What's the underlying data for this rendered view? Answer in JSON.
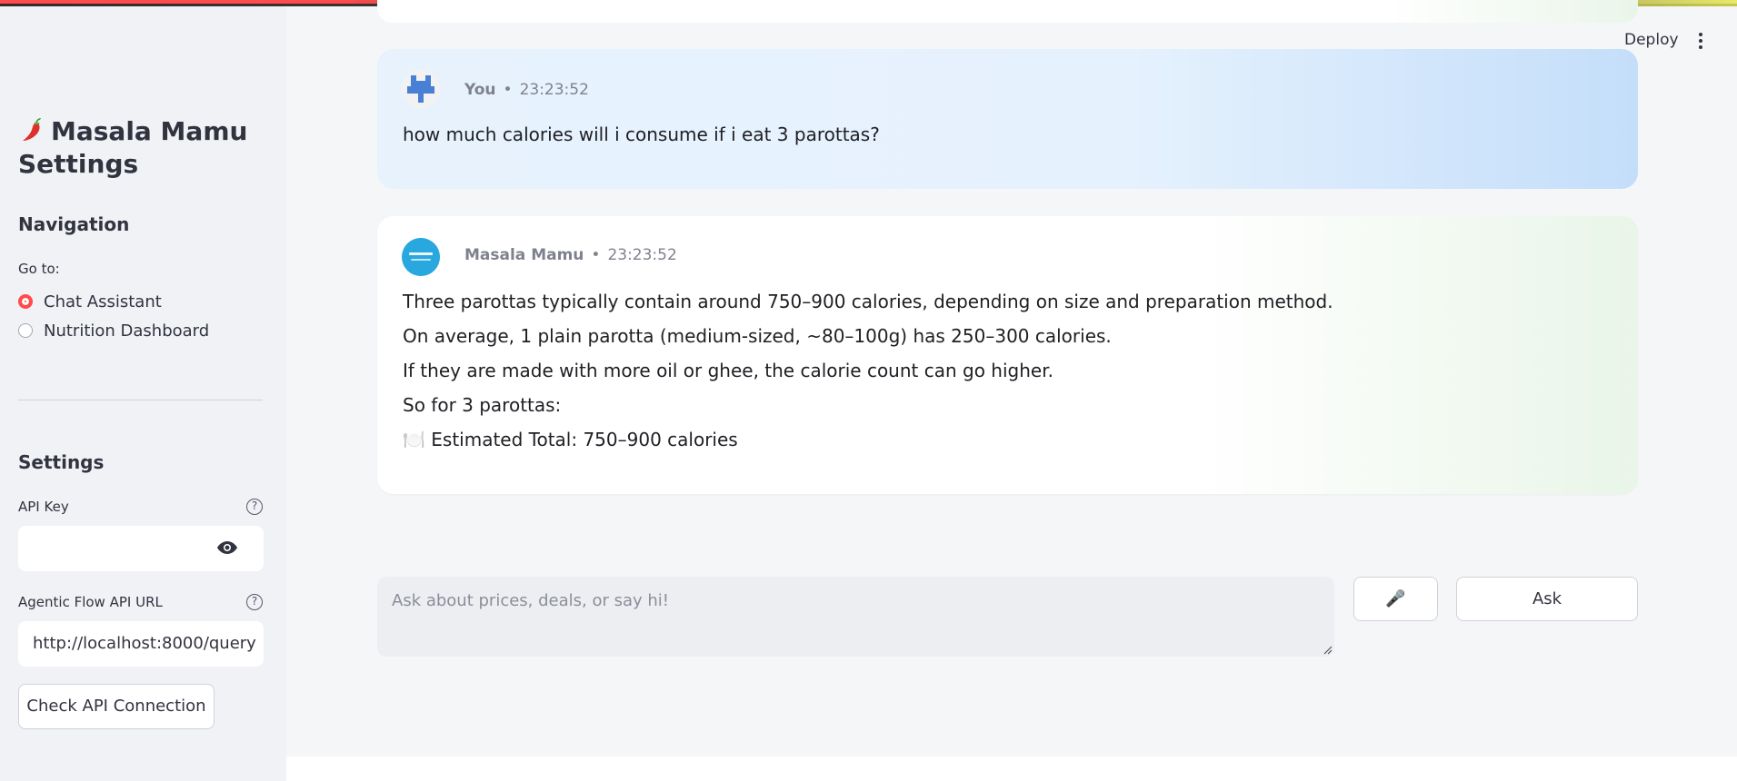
{
  "app": {
    "deploy_label": "Deploy"
  },
  "sidebar": {
    "title_line1": "Masala Mamu",
    "title_line2": "Settings",
    "navigation_heading": "Navigation",
    "goto_label": "Go to:",
    "nav_options": [
      {
        "label": "Chat Assistant",
        "selected": true
      },
      {
        "label": "Nutrition Dashboard",
        "selected": false
      }
    ],
    "settings_heading": "Settings",
    "api_key_label": "API Key",
    "api_key_value": "",
    "api_url_label": "Agentic Flow API URL",
    "api_url_value": "http://localhost:8000/query",
    "check_button": "Check API Connection"
  },
  "chat": {
    "messages": [
      {
        "sender": "You",
        "time": "23:23:52",
        "lines": [
          "how much calories will i consume if i eat 3 parottas?"
        ]
      },
      {
        "sender": "Masala Mamu",
        "time": "23:23:52",
        "lines": [
          "Three parottas typically contain around 750–900 calories, depending on size and preparation method.",
          "On average, 1 plain parotta (medium-sized, ~80–100g) has 250–300 calories.",
          "If they are made with more oil or ghee, the calorie count can go higher.",
          "So for 3 parottas:",
          "🍽️ Estimated Total: 750–900 calories"
        ]
      }
    ],
    "input_placeholder": "Ask about prices, deals, or say hi!",
    "mic_label": "🎤",
    "ask_label": "Ask"
  },
  "colors": {
    "accent": "#ff4b4b",
    "user_bubble": "#e5f1fd",
    "bot_bubble": "#ffffff"
  }
}
